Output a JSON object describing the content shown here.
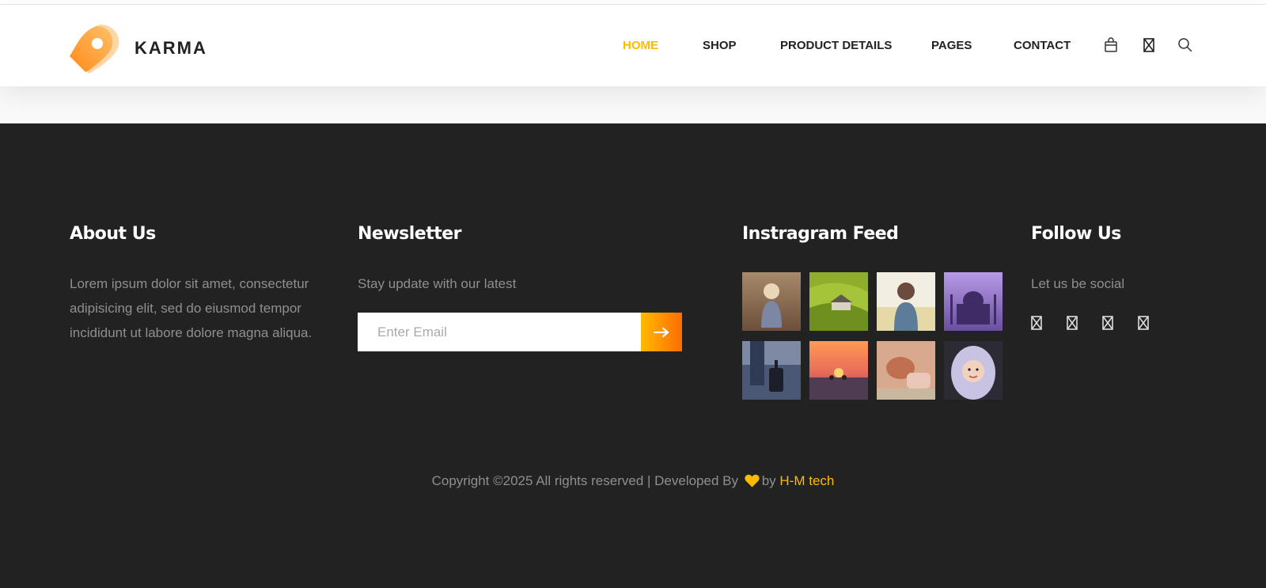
{
  "header": {
    "logo_text": "KARMA",
    "nav": [
      {
        "label": "HOME",
        "active": true
      },
      {
        "label": "SHOP",
        "active": false
      },
      {
        "label": "PRODUCT DETAILS",
        "active": false
      },
      {
        "label": "PAGES",
        "active": false
      },
      {
        "label": "CONTACT",
        "active": false
      }
    ],
    "icons": [
      "shopping-bag-icon",
      "missing-glyph-icon",
      "search-icon"
    ]
  },
  "footer": {
    "about": {
      "title": "About Us",
      "text": "Lorem ipsum dolor sit amet, consectetur adipisicing elit, sed do eiusmod tempor incididunt ut labore dolore magna aliqua."
    },
    "newsletter": {
      "title": "Newsletter",
      "text": "Stay update with our latest",
      "placeholder": "Enter Email",
      "submit_icon": "arrow-right-icon"
    },
    "instagram": {
      "title": "Instragram Feed",
      "photos": [
        "child-in-field",
        "green-hills-hut",
        "girl-backpack",
        "taj-mahal-purple",
        "traveler-suitcase",
        "sunset-sea",
        "sitting-couple",
        "child-winter-hood"
      ]
    },
    "follow": {
      "title": "Follow Us",
      "text": "Let us be social",
      "icons": [
        "social-icon-1",
        "social-icon-2",
        "social-icon-3",
        "social-icon-4"
      ]
    },
    "copyright": {
      "prefix": "Copyright ©2025 All rights reserved | Developed By",
      "by": "by",
      "brand": "H-M tech"
    }
  },
  "colors": {
    "accent": "#ffba00",
    "accent_end": "#ff6c00",
    "footer_bg": "#222222",
    "muted_text": "#8f8f8f"
  }
}
